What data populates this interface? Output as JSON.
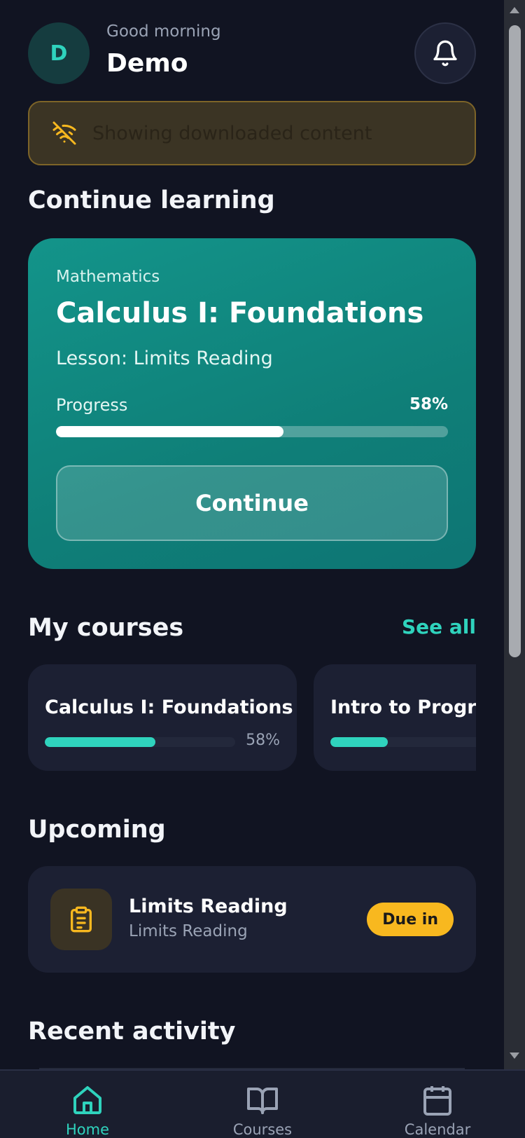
{
  "header": {
    "avatar_initial": "D",
    "greeting": "Good morning",
    "username": "Demo"
  },
  "banner": {
    "text": "Showing downloaded content",
    "icon": "wifi-off-icon"
  },
  "continue_learning": {
    "section_title": "Continue learning",
    "subject": "Mathematics",
    "course_title": "Calculus I: Foundations",
    "lesson": "Lesson: Limits Reading",
    "progress_label": "Progress",
    "progress_text": "58%",
    "progress_fraction": 0.58,
    "button_label": "Continue"
  },
  "my_courses": {
    "section_title": "My courses",
    "see_all": "See all",
    "items": [
      {
        "name": "Calculus I: Foundations",
        "progress_text": "58%",
        "progress_fraction": 0.58
      },
      {
        "name": "Intro to Progra",
        "progress_fraction": 0.3
      }
    ]
  },
  "upcoming": {
    "section_title": "Upcoming",
    "items": [
      {
        "title": "Limits Reading",
        "subtitle": "Limits Reading",
        "badge": "Due in",
        "icon": "clipboard-icon"
      }
    ]
  },
  "recent_activity": {
    "section_title": "Recent activity"
  },
  "bottom_nav": {
    "items": [
      {
        "label": "Home",
        "icon": "home-icon",
        "active": true
      },
      {
        "label": "Courses",
        "icon": "book-icon",
        "active": false
      },
      {
        "label": "Calendar",
        "icon": "calendar-icon",
        "active": false
      }
    ]
  },
  "colors": {
    "background": "#111422",
    "accent": "#2fd3bd",
    "card": "#1c2033",
    "warning": "#f8b81f"
  }
}
